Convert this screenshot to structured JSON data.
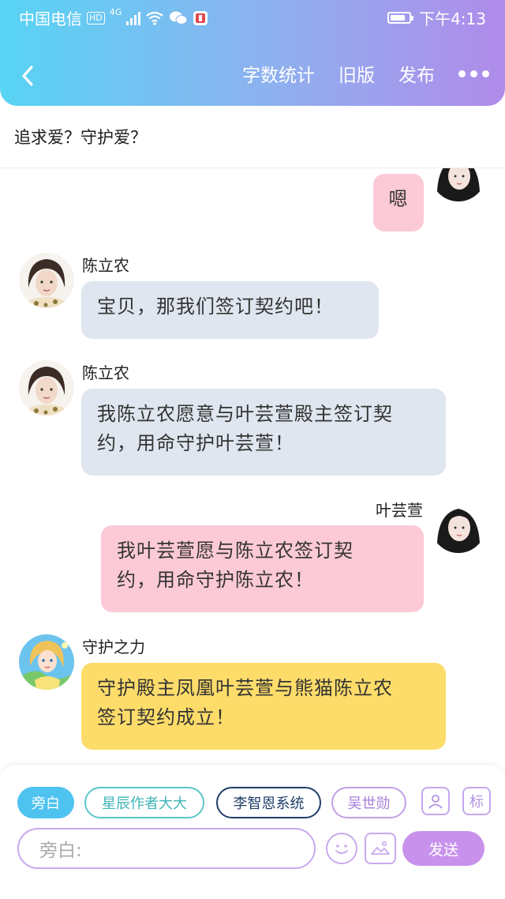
{
  "status_bar": {
    "carrier": "中国电信",
    "hd": "HD",
    "network": "4G",
    "battery_level": 0.8,
    "time": "下午4:13"
  },
  "nav": {
    "back_icon": "chevron-left-icon",
    "word_count": "字数统计",
    "old_version": "旧版",
    "publish": "发布",
    "more_icon": "more-dots-icon"
  },
  "story": {
    "title": "追求爱？守护爱？"
  },
  "messages": [
    {
      "side": "right",
      "speaker": "",
      "text": "嗯",
      "color": "#fccad6"
    },
    {
      "side": "left",
      "speaker": "陈立农",
      "text": "宝贝，那我们签订契约吧！",
      "color": "#dfe6ef"
    },
    {
      "side": "left",
      "speaker": "陈立农",
      "line1": "我陈立农愿意与叶芸萱殿主签订契",
      "line2": "约，用命守护叶芸萱！",
      "color": "#dfe6ef"
    },
    {
      "side": "right",
      "speaker": "叶芸萱",
      "line1": "我叶芸萱愿与陈立农签订契",
      "line2": "约，用命守护陈立农！",
      "color": "#fccad6"
    },
    {
      "side": "left",
      "speaker": "守护之力",
      "line1": "守护殿主凤凰叶芸萱与熊猫陈立农",
      "line2": "签订契约成立！",
      "color": "#fddc6a"
    }
  ],
  "composer": {
    "roles": [
      {
        "label": "旁白",
        "selected": true
      },
      {
        "label": "星辰作者大大",
        "color": "#5cc6c8"
      },
      {
        "label": "李智恩系统",
        "color": "#1f3f6a"
      },
      {
        "label": "吴世勋",
        "color": "#c3a0e8"
      }
    ],
    "contact_icon": "contact-card-icon",
    "tag_icon_label": "标",
    "placeholder": "旁白:",
    "emoji_icon": "smiley-icon",
    "image_icon": "image-icon",
    "send_label": "发送"
  }
}
